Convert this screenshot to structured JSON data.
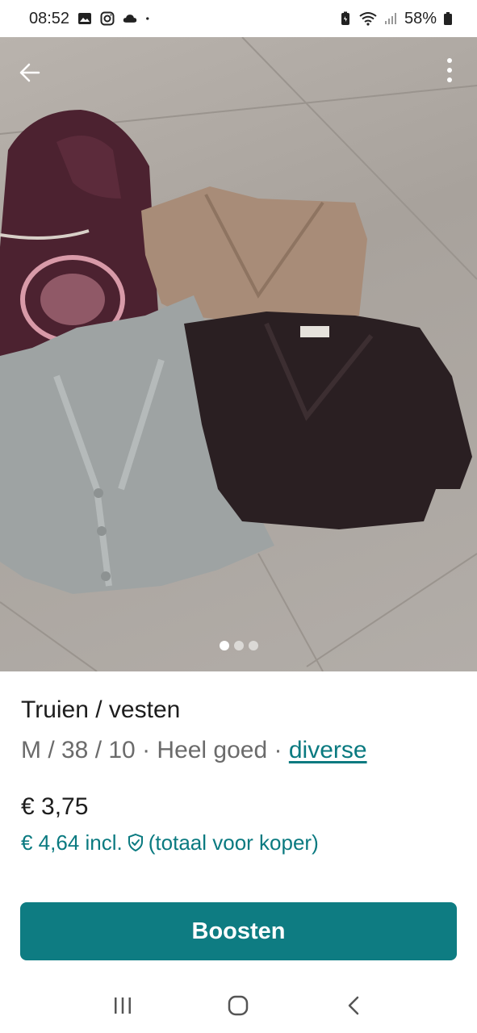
{
  "status_bar": {
    "time": "08:52",
    "battery": "58%",
    "left_icons": [
      "gallery-icon",
      "instagram-icon",
      "cloud-icon",
      "dot-icon"
    ],
    "right_icons": [
      "battery-saver-icon",
      "wifi-icon",
      "signal-icon",
      "battery-icon"
    ]
  },
  "gallery": {
    "image_count": 3,
    "active_index": 0
  },
  "listing": {
    "title": "Truien / vesten",
    "meta_text": "M / 38 / 10 · Heel goed · ",
    "meta_link": "diverse",
    "price": "€ 3,75",
    "price_incl": "€ 4,64  incl.",
    "price_incl_note": "(totaal voor koper)"
  },
  "actions": {
    "boost_label": "Boosten"
  },
  "colors": {
    "accent": "#0e7c82",
    "link": "#0a7a80"
  }
}
